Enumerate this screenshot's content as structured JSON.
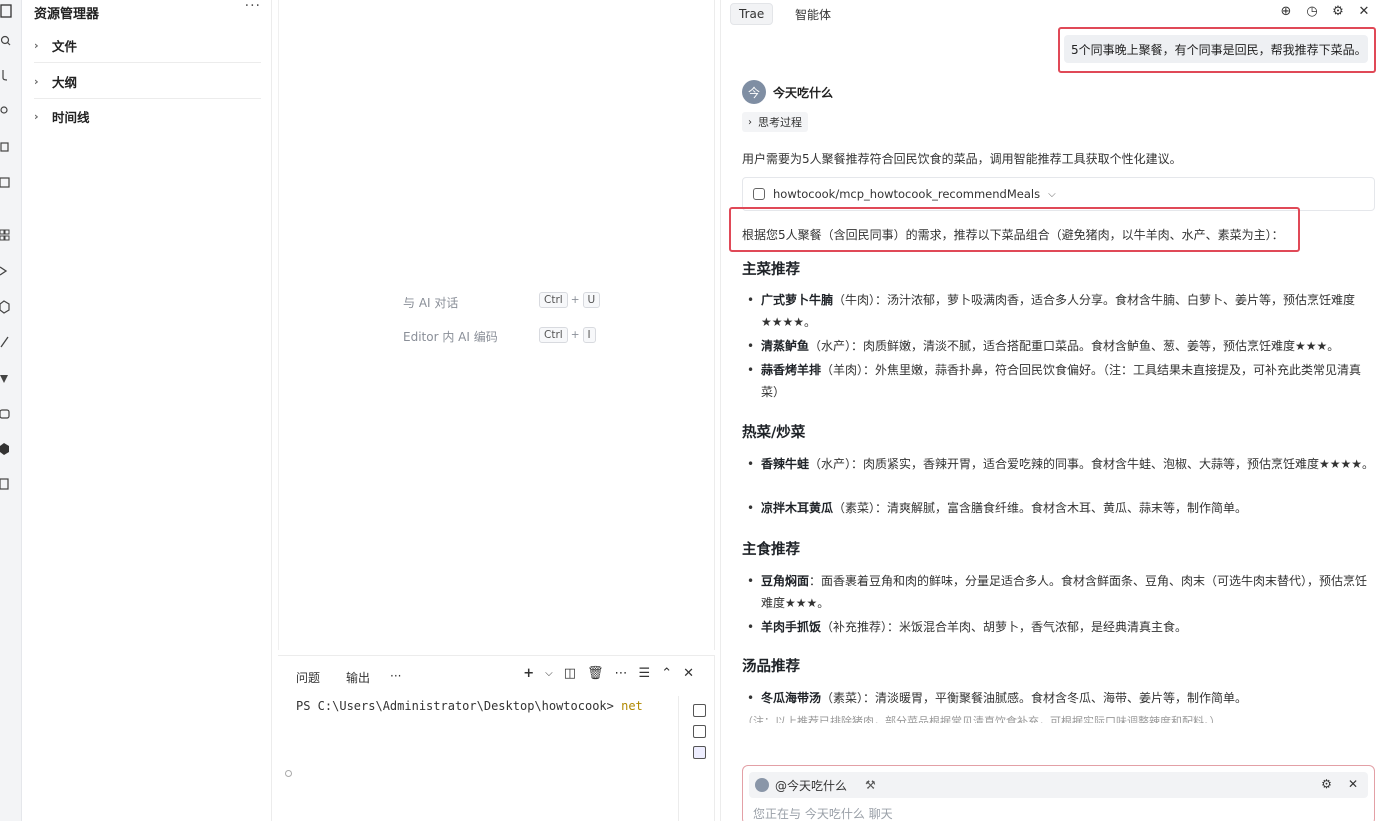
{
  "explorer": {
    "title": "资源管理器",
    "more": "···",
    "sections": [
      {
        "label": "文件"
      },
      {
        "label": "大纲"
      },
      {
        "label": "时间线"
      }
    ]
  },
  "editor": {
    "hints": [
      {
        "label": "与 AI 对话",
        "key1": "Ctrl",
        "plus": "+",
        "key2": "U"
      },
      {
        "label": "Editor 内 AI 编码",
        "key1": "Ctrl",
        "plus": "+",
        "key2": "I"
      }
    ]
  },
  "panel": {
    "tabs": [
      "问题",
      "输出",
      "···"
    ],
    "terminal_prompt": "PS C:\\Users\\Administrator\\Desktop\\howtocook> ",
    "terminal_cmd": "net"
  },
  "chat": {
    "tabs": [
      "Trae",
      "智能体"
    ],
    "user_message": "5个同事晚上聚餐，有个同事是回民，帮我推荐下菜品。",
    "agent_name": "今天吃什么",
    "thinking_label": "思考过程",
    "intro": "用户需要为5人聚餐推荐符合回民饮食的菜品，调用智能推荐工具获取个性化建议。",
    "tool_call": "howtocook/mcp_howtocook_recommendMeals",
    "lead": "根据您5人聚餐（含回民同事）的需求，推荐以下菜品组合（避免猪肉，以牛羊肉、水产、素菜为主）：",
    "sections": [
      {
        "title": "主菜推荐",
        "items": [
          {
            "name": "广式萝卜牛腩",
            "rest": "（牛肉）：汤汁浓郁，萝卜吸满肉香，适合多人分享。食材含牛腩、白萝卜、姜片等，预估烹饪难度★★★★。"
          },
          {
            "name": "清蒸鲈鱼",
            "rest": "（水产）：肉质鲜嫩，清淡不腻，适合搭配重口菜品。食材含鲈鱼、葱、姜等，预估烹饪难度★★★。"
          },
          {
            "name": "蒜香烤羊排",
            "rest": "（羊肉）：外焦里嫩，蒜香扑鼻，符合回民饮食偏好。（注：工具结果未直接提及，可补充此类常见清真菜）"
          }
        ]
      },
      {
        "title": "热菜/炒菜",
        "items": [
          {
            "name": "香辣牛蛙",
            "rest": "（水产）：肉质紧实，香辣开胃，适合爱吃辣的同事。食材含牛蛙、泡椒、大蒜等，预估烹饪难度★★★★。"
          },
          {
            "name": "凉拌木耳黄瓜",
            "rest": "（素菜）：清爽解腻，富含膳食纤维。食材含木耳、黄瓜、蒜末等，制作简单。"
          }
        ]
      },
      {
        "title": "主食推荐",
        "items": [
          {
            "name": "豆角焖面",
            "rest": "：面香裹着豆角和肉的鲜味，分量足适合多人。食材含鲜面条、豆角、肉末（可选牛肉末替代），预估烹饪难度★★★。"
          },
          {
            "name": "羊肉手抓饭",
            "rest": "（补充推荐）：米饭混合羊肉、胡萝卜，香气浓郁，是经典清真主食。"
          }
        ]
      },
      {
        "title": "汤品推荐",
        "items": [
          {
            "name": "冬瓜海带汤",
            "rest": "（素菜）：清淡暖胃，平衡聚餐油腻感。食材含冬瓜、海带、姜片等，制作简单。"
          }
        ]
      }
    ],
    "cut_text": "（注：以上推荐已排除猪肉，部分菜品根据常见清真饮食补充，可根据实际口味调整辣度和配料。）",
    "input_agent": "@今天吃什么",
    "input_placeholder": "您正在与 今天吃什么 聊天"
  },
  "colors": {
    "highlight": "#e04957",
    "accent": "#7f8ea3"
  }
}
